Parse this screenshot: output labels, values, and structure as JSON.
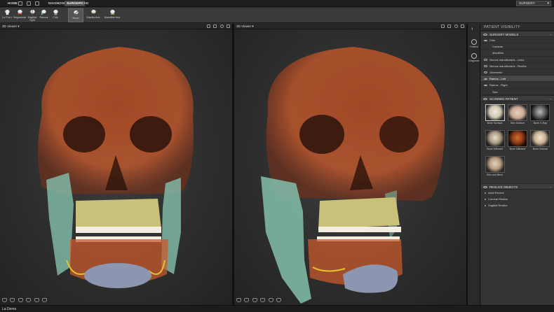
{
  "menubar": {
    "items": [
      {
        "label": "HOME"
      },
      {
        "label": "DIAGNOSE"
      },
      {
        "label": "SURGERY"
      },
      {
        "label": "CAD"
      }
    ],
    "mode_value": "SURGERY"
  },
  "ribbon": {
    "buttons": [
      {
        "label": "Le Fort I",
        "icon": "lefort-icon"
      },
      {
        "label": "Segmental",
        "icon": "segmental-icon"
      },
      {
        "label": "Sagittal Split",
        "icon": "sagittal-split-icon"
      },
      {
        "label": "Ramus",
        "icon": "ramus-icon"
      },
      {
        "label": "Chin",
        "icon": "chin-icon"
      },
      {
        "label": "None",
        "icon": "none-icon"
      },
      {
        "label": "Maxilla first",
        "icon": "maxilla-first-icon"
      },
      {
        "label": "Mandible first",
        "icon": "mandible-first-icon"
      }
    ]
  },
  "viewers": {
    "left_title": "3D Viewer",
    "right_title": "3D Viewer"
  },
  "strip": {
    "patient_label": "Patient",
    "diagnose_label": "Diagnose"
  },
  "panel": {
    "title": "PATIENT VISIBILITY",
    "surgery_models": {
      "header": "SURGERY MODELS",
      "items": [
        {
          "label": "Chin"
        },
        {
          "label": "Cranium"
        },
        {
          "label": "Mandible"
        },
        {
          "label": "Nervus mandibularis - Links"
        },
        {
          "label": "Nervus mandibularis - Rechts"
        },
        {
          "label": "Oberkiefer"
        },
        {
          "label": "Ramus - Left"
        },
        {
          "label": "Ramus - Right"
        },
        {
          "label": "Skin"
        }
      ]
    },
    "scanned_patient": {
      "header": "SCANNED PATIENT",
      "thumbs": [
        {
          "label": "Bone Surface"
        },
        {
          "label": "Skin Surface"
        },
        {
          "label": "Bone X-Ray"
        },
        {
          "label": "Bone Diffused"
        },
        {
          "label": "Bone Diffused"
        },
        {
          "label": "Bone Natural"
        },
        {
          "label": "Skin and Bone"
        }
      ]
    },
    "reslice": {
      "header": "RESLICE OBJECTS",
      "items": [
        {
          "label": "Axial Reslice"
        },
        {
          "label": "Coronal Reslice"
        },
        {
          "label": "Sagittal Reslice"
        }
      ]
    }
  },
  "status": {
    "text": "La Demo"
  },
  "colors": {
    "bone": "#cc5a2a",
    "teeth_bone": "#c9c07a",
    "ramus": "#7fb7a5",
    "chin": "#8c96b0",
    "nerve": "#e6c22c"
  }
}
